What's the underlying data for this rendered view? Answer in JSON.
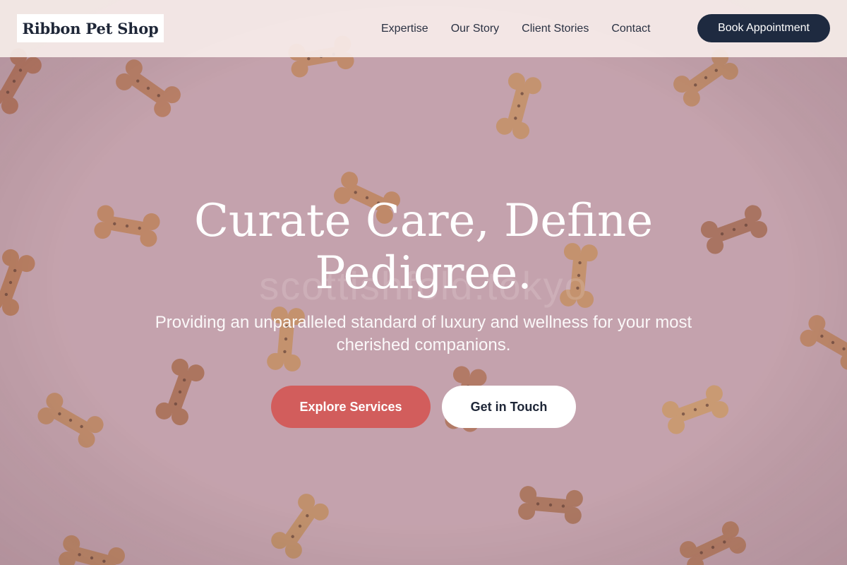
{
  "header": {
    "logo_text": "Ribbon Pet Shop",
    "nav": [
      {
        "label": "Expertise"
      },
      {
        "label": "Our Story"
      },
      {
        "label": "Client Stories"
      },
      {
        "label": "Contact"
      }
    ],
    "cta_label": "Book Appointment"
  },
  "hero": {
    "title": "Curate Care, Define Pedigree.",
    "subtitle": "Providing an unparalleled standard of luxury and wellness for your most cherished companions.",
    "watermark": "scottishfold.tokyo",
    "primary_button": "Explore Services",
    "secondary_button": "Get in Touch",
    "background_image": "dog-bone-biscuits-on-pink"
  },
  "colors": {
    "header_bg": "#f6ece8",
    "brand_dark": "#1e2a40",
    "accent": "#d25d5c",
    "hero_bg": "#c8a7b1"
  }
}
